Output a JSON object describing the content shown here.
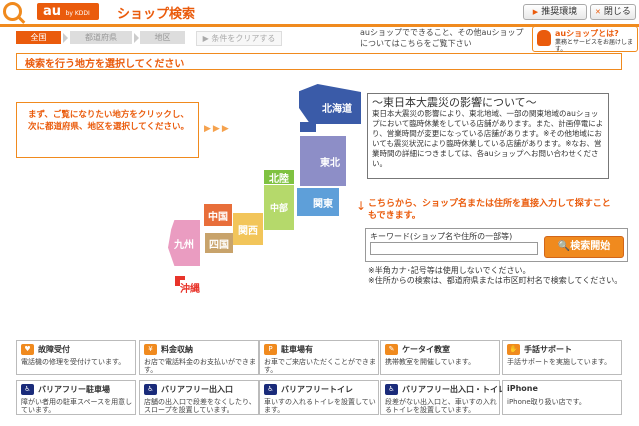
{
  "header": {
    "brand": "au",
    "brand_sub": "by KDDI",
    "title": "ショップ検索",
    "env_button": "推奨環境",
    "close_button": "閉じる"
  },
  "steps": {
    "all": "全国",
    "pref": "都道府県",
    "area": "地区",
    "clear": "条件をクリアする"
  },
  "top_note": "auショップでできること、その他auショップについてはこちらをご覧下さい",
  "au_shop_what": {
    "title": "auショップとは?",
    "sub": "業務とサービスをお届けします。"
  },
  "instruction": "検索を行う地方を選択してください",
  "guide": "まず、ご覧になりたい地方をクリックし、次に都道府県、地区を選択してください。",
  "guide_arrows": "▶▶▶",
  "map": {
    "hokkaido": "北海道",
    "tohoku": "東北",
    "kanto": "関東",
    "hokuriku": "北陸",
    "chubu": "中部",
    "kansai": "関西",
    "chugoku": "中国",
    "shikoku": "四国",
    "kyushu": "九州",
    "okinawa": "沖縄"
  },
  "quake": {
    "title": "～東日本大震災の影響について～",
    "body": "東日本大震災の影響により、東北地域、一部の関東地域のauショップにおいて臨時休業をしている店舗があります。また、計画停電により、営業時間が変更になっている店舗があります。※その他地域においても震災状況により臨時休業している店舗があります。※なお、営業時間の詳細につきましては、各auショップへお問い合わせください。"
  },
  "keyword": {
    "heading": "こちらから、ショップ名または住所を直接入力して探すこともできます。",
    "label": "キーワード(ショップ名や住所の一部等)",
    "value": "",
    "button": "検索開始",
    "note1": "※半角カナ･記号等は使用しないでください。",
    "note2": "※住所からの検索は、都道府県または市区町村名で検索してください。"
  },
  "services": [
    {
      "icon": "heart-icon",
      "title": "故障受付",
      "desc": "電話機の修理を受付けています。"
    },
    {
      "icon": "yen-icon",
      "title": "料金収納",
      "desc": "お店で電話料金のお支払いができます。"
    },
    {
      "icon": "parking-icon",
      "title": "駐車場有",
      "desc": "お車でご来店いただくことができます。"
    },
    {
      "icon": "classroom-icon",
      "title": "ケータイ教室",
      "desc": "携帯教室を開催しています。"
    },
    {
      "icon": "handsign-icon",
      "title": "手話サポート",
      "desc": "手話サポートを実施しています。"
    },
    {
      "icon": "barrierfree-parking-icon",
      "title": "バリアフリー駐車場",
      "desc": "障がい者用の駐車スペースを用意しています。"
    },
    {
      "icon": "barrierfree-entrance-icon",
      "title": "バリアフリー出入口",
      "desc": "店舗の出入口で段差をなくしたり、スロープを設置しています。"
    },
    {
      "icon": "barrierfree-toilet-icon",
      "title": "バリアフリートイレ",
      "desc": "車いすの入れるトイレを設置しています。"
    },
    {
      "icon": "barrierfree-entrance-toilet-icon",
      "title": "バリアフリー出入口・トイレ",
      "desc": "段差がない出入口と、車いすの入れるトイレを設置しています。"
    },
    {
      "icon": "iphone-icon",
      "title": "iPhone",
      "desc": "iPhone取り扱い店です。"
    }
  ]
}
